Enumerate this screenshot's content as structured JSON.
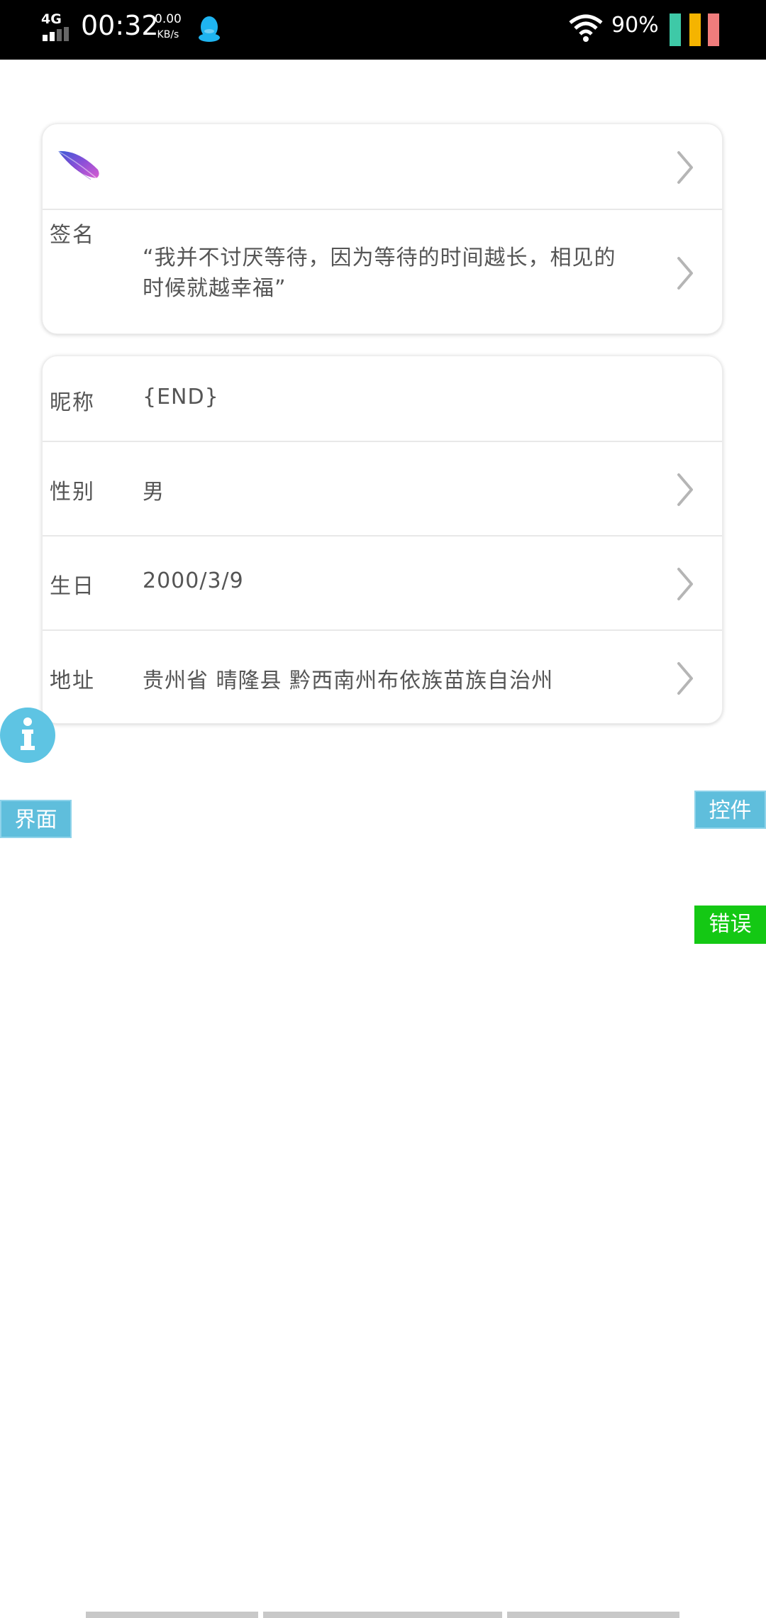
{
  "status_bar": {
    "network": "4G",
    "time": "00:32",
    "speed_value": "0.00",
    "speed_unit": "KB/s",
    "battery": "90%",
    "icons": [
      "signal-icon",
      "qq-icon",
      "wifi-icon"
    ]
  },
  "profile": {
    "avatar_icon": "feather-logo",
    "signature_label": "签名",
    "signature_text": "“我并不讨厌等待，因为等待的时间越长，相见的时候就越幸福”"
  },
  "info": {
    "nickname_label": "昵称",
    "nickname_value": "{END}",
    "gender_label": "性别",
    "gender_value": "男",
    "birthday_label": "生日",
    "birthday_value": "2000/3/9",
    "address_label": "地址",
    "address_value": "贵州省 晴隆县 黔西南州布依族苗族自治州"
  },
  "floating": {
    "ui_tag": "界面",
    "control_tag": "控件",
    "error_tag": "错误"
  },
  "colors": {
    "accent_blue": "#5fbedc",
    "error_green": "#14c814",
    "divider": "#e8e8e8",
    "text": "#555555"
  }
}
